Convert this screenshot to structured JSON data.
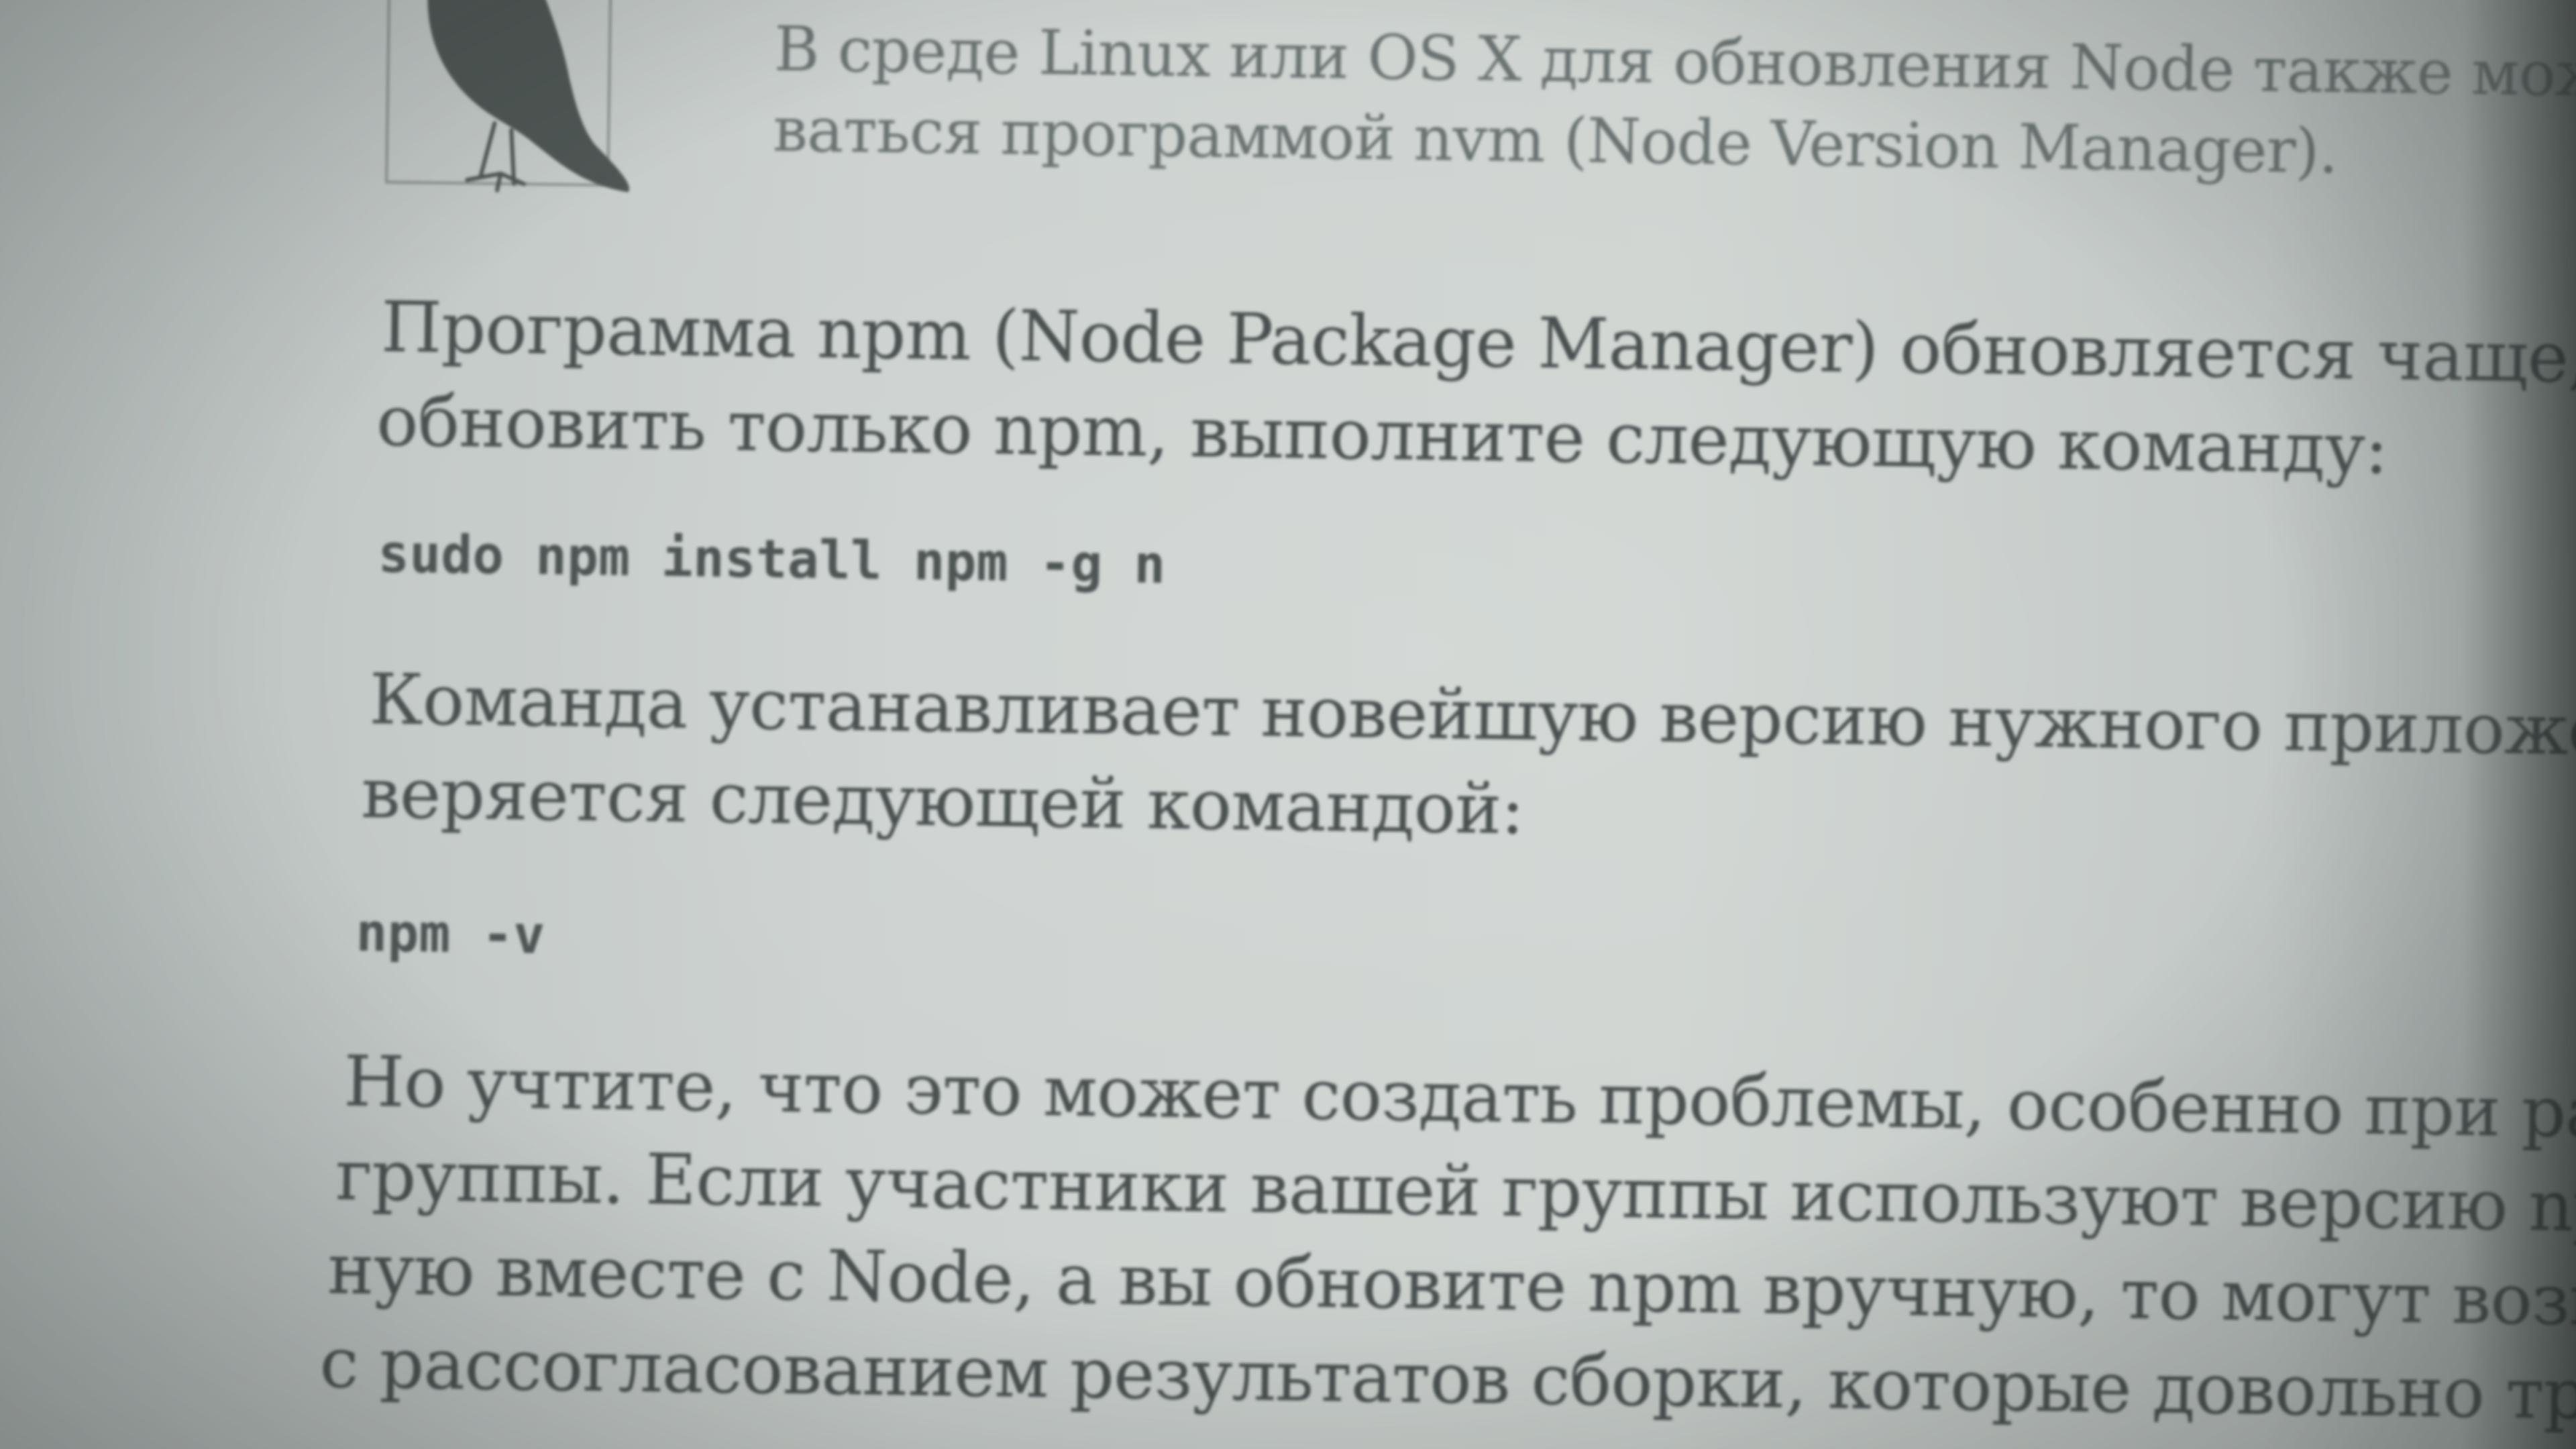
{
  "note": {
    "icon": "crow-icon",
    "lines": [
      "В среде Linux или OS X для обновления Node также можно поль-",
      "ваться программой nvm (Node Version Manager)."
    ]
  },
  "paragraphs": [
    {
      "lines": [
        "Программа npm (Node Package Manager) обновляется чаще, чем Node. Ч",
        "обновить только npm, выполните следующую команду:"
      ]
    },
    {
      "lines": [
        "Команда устанавливает новейшую версию нужного приложения. Верси",
        "веряется следующей командой:"
      ]
    },
    {
      "lines": [
        "Но учтите, что это может создать проблемы, особенно при работе в со",
        "группы. Если участники вашей группы используют версию npm, устан",
        "ную вместе с Node, а вы обновите npm вручную, то могут возникнуть про",
        "с рассогласованием результатов сборки, которые довольно трудно обнару"
      ]
    }
  ],
  "code": [
    "sudo npm install npm -g n",
    "npm -v"
  ],
  "colors": {
    "paper": "#cdd2d0",
    "ink": "#4a5150",
    "icon": "#4f5654"
  }
}
